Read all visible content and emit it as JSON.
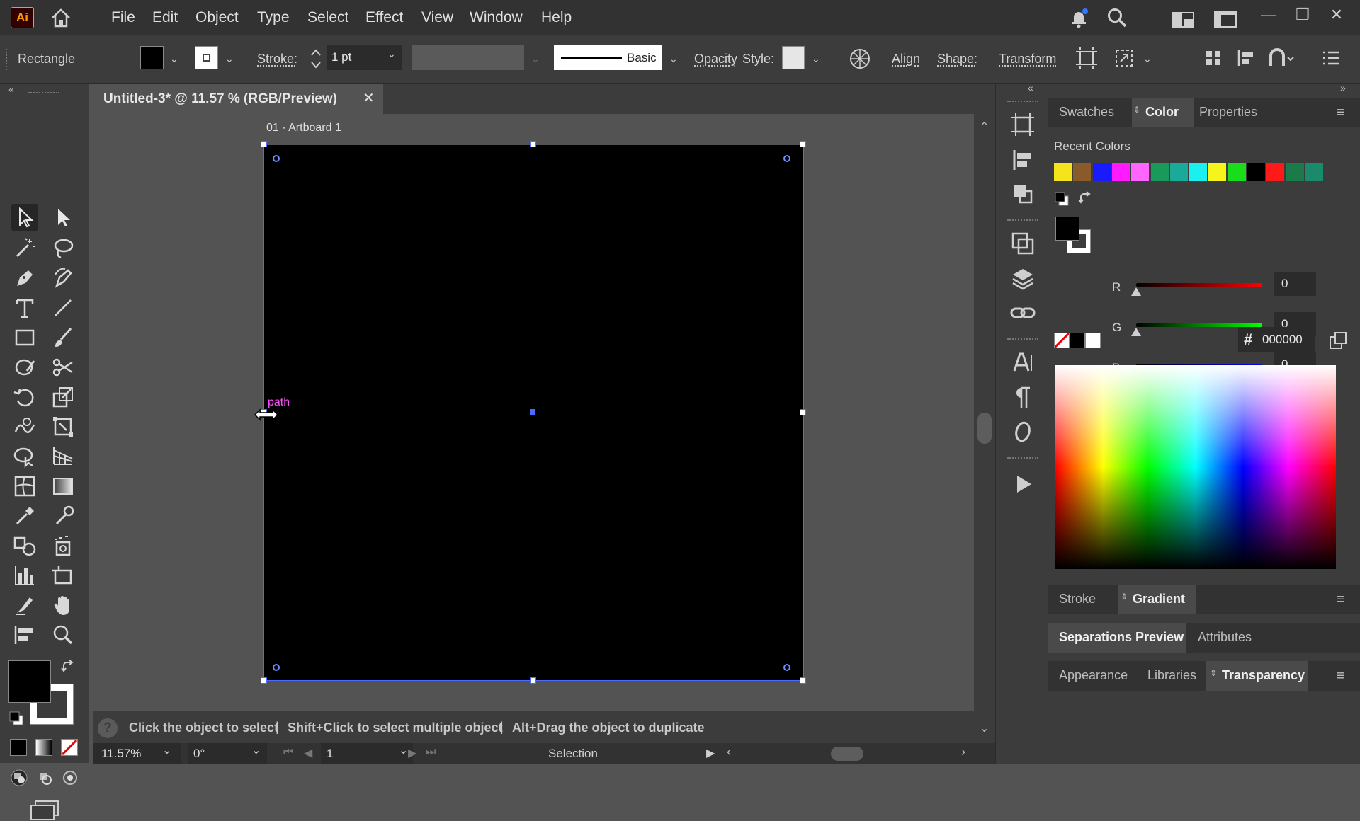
{
  "app": {
    "logo": "Ai"
  },
  "menu": [
    "File",
    "Edit",
    "Object",
    "Type",
    "Select",
    "Effect",
    "View",
    "Window",
    "Help"
  ],
  "control": {
    "tool_name": "Rectangle",
    "stroke_label": "Stroke:",
    "stroke_value": "1 pt",
    "brush_label": "Basic",
    "opacity_label": "Opacity",
    "style_label": "Style:",
    "align_label": "Align",
    "shape_label": "Shape:",
    "transform_label": "Transform"
  },
  "document": {
    "tab_title": "Untitled-3* @ 11.57 % (RGB/Preview)",
    "artboard_label": "01 - Artboard 1",
    "hover_label": "path"
  },
  "status": {
    "hint_1": "Click the object to select",
    "hint_2": "Shift+Click to select multiple object",
    "hint_3": "Alt+Drag the object to duplicate",
    "zoom": "11.57%",
    "rotation": "0°",
    "artboard_num": "1",
    "tool_status": "Selection"
  },
  "panel": {
    "tabs_top": [
      "Swatches",
      "Color",
      "Properties"
    ],
    "recent_colors_label": "Recent Colors",
    "recent_colors": [
      "#f5e41c",
      "#8a5a2b",
      "#1a1aff",
      "#ff1aff",
      "#ff66ff",
      "#1a9a5a",
      "#1aaa99",
      "#1af0f0",
      "#f5f51c",
      "#1adc1a",
      "#000000",
      "#ff1a1a",
      "#1a7a4a",
      "#1a8a6a"
    ],
    "channels": [
      {
        "label": "R",
        "value": "0",
        "grad_from": "#000000",
        "grad_to": "#ff0000"
      },
      {
        "label": "G",
        "value": "0",
        "grad_from": "#000000",
        "grad_to": "#00ff00"
      },
      {
        "label": "B",
        "value": "0",
        "grad_from": "#000000",
        "grad_to": "#0000ff"
      }
    ],
    "hex_symbol": "#",
    "hex_value": "000000",
    "tabs_mid": [
      "Stroke",
      "Gradient"
    ],
    "tabs_sep": [
      "Separations Preview",
      "Attributes"
    ],
    "tabs_bottom": [
      "Appearance",
      "Libraries",
      "Transparency"
    ]
  }
}
